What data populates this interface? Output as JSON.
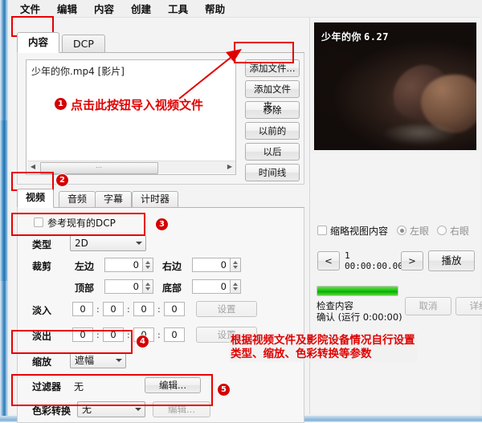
{
  "window": {
    "menu": [
      "文件",
      "编辑",
      "内容",
      "创建",
      "工具",
      "帮助"
    ]
  },
  "tabs": {
    "main": [
      {
        "label": "内容",
        "active": true
      },
      {
        "label": "DCP",
        "active": false
      }
    ]
  },
  "content_panel": {
    "file_item": "少年的你.mp4 [影片]",
    "scroll_thumb_grip": "⋯",
    "scroll_left_arrow": "◀",
    "scroll_right_arrow": "▶",
    "buttons": [
      "添加文件...",
      "添加文件夹...",
      "移除",
      "以前的",
      "以后",
      "时间线"
    ]
  },
  "sub_tabs": [
    {
      "label": "视频",
      "active": true
    },
    {
      "label": "音频",
      "active": false
    },
    {
      "label": "字幕",
      "active": false
    },
    {
      "label": "计时器",
      "active": false
    }
  ],
  "video_settings": {
    "reference_dcp": {
      "label": "参考现有的DCP",
      "checked": false
    },
    "type": {
      "label": "类型",
      "value": "2D"
    },
    "crop": {
      "label": "裁剪",
      "left_label": "左边",
      "left_value": "0",
      "right_label": "右边",
      "right_value": "0",
      "top_label": "顶部",
      "top_value": "0",
      "bottom_label": "底部",
      "bottom_value": "0"
    },
    "fade_in": {
      "label": "淡入",
      "values": [
        "0",
        "0",
        "0",
        "0"
      ],
      "button": "设置"
    },
    "fade_out": {
      "label": "淡出",
      "values": [
        "0",
        "0",
        "0",
        "0"
      ],
      "button": "设置"
    },
    "scale": {
      "label": "缩放",
      "value": "遮幅"
    },
    "filter": {
      "label": "过滤器",
      "value": "无",
      "button": "编辑..."
    },
    "colour_conversion": {
      "label": "色彩转换",
      "value": "无",
      "button": "编辑..."
    },
    "separator": ":"
  },
  "preview": {
    "watermark_title": "少年的你",
    "watermark_date": "6.27",
    "thumb_checkbox": {
      "label": "缩略视图内容",
      "checked": false
    },
    "eye_left": {
      "label": "左眼",
      "selected": true
    },
    "eye_right": {
      "label": "右眼",
      "selected": false
    },
    "prev_button": "<",
    "next_button": ">",
    "frame_number": "1",
    "timecode": "00:00:00.00",
    "play_button": "播放",
    "progress_percent": 100,
    "status_line1": "检查内容",
    "status_line2": "确认 (运行 0:00:00)",
    "cancel_button": "取消",
    "details_button": "详细"
  },
  "annotations": {
    "badge1": "1",
    "badge2": "2",
    "badge3": "3",
    "badge4": "4",
    "badge5": "5",
    "note1": "点击此按钮导入视频文件",
    "note2_line1": "根据视频文件及影院设备情况自行设置",
    "note2_line2": "类型、缩放、色彩转换等参数"
  },
  "colors": {
    "annotation_red": "#e00000",
    "badge_red": "#d40000",
    "progress_green": "#17c60d"
  }
}
